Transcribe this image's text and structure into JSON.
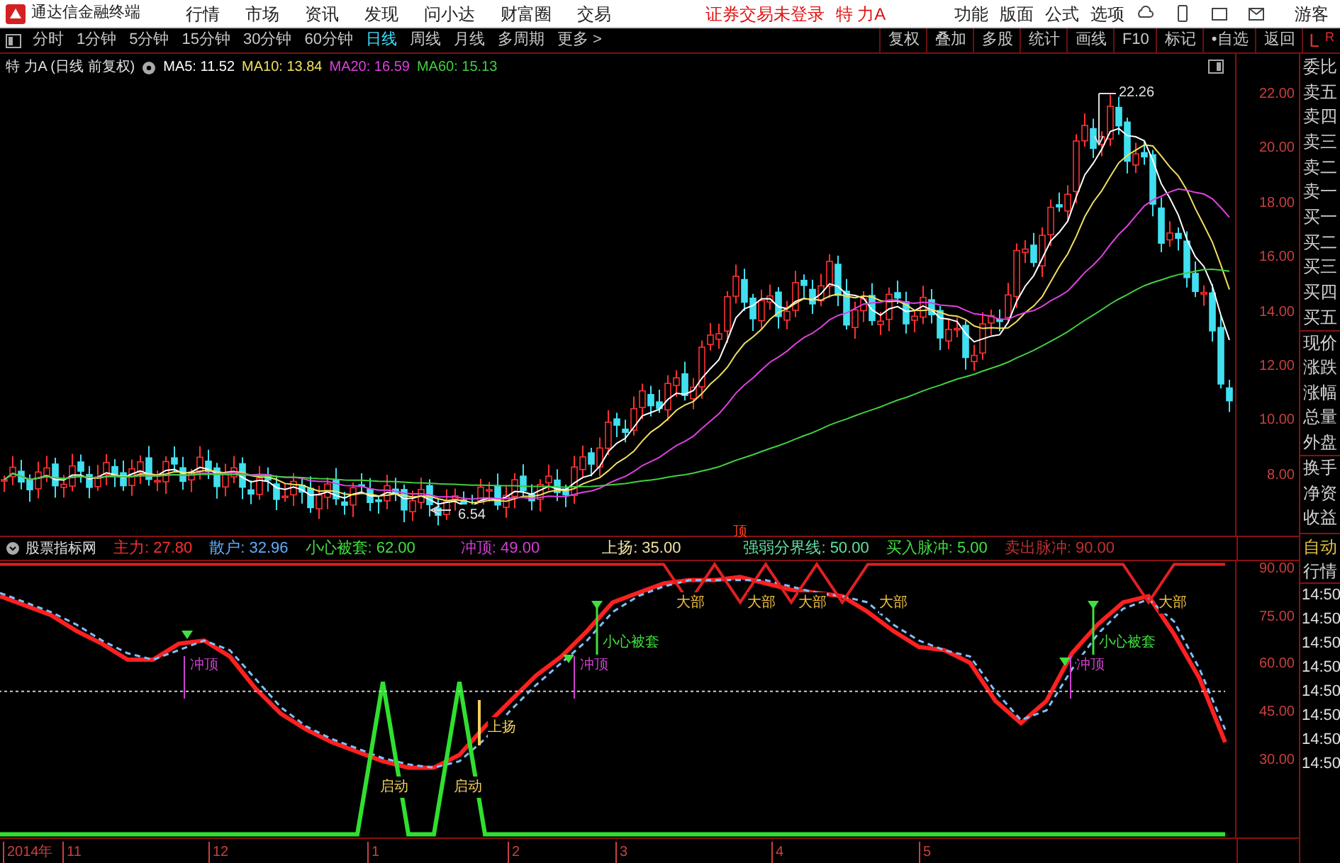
{
  "menu_bar": {
    "title": "通达信金融终端",
    "menu": [
      "行情",
      "市场",
      "资讯",
      "发现",
      "问小达",
      "财富圈",
      "交易"
    ],
    "notice": "证券交易未登录",
    "stock": "特 力A",
    "tools": [
      "功能",
      "版面",
      "公式",
      "选项"
    ],
    "user": "游客"
  },
  "toolbar": {
    "periods": [
      {
        "label": "分时",
        "selected": false
      },
      {
        "label": "1分钟",
        "selected": false
      },
      {
        "label": "5分钟",
        "selected": false
      },
      {
        "label": "15分钟",
        "selected": false
      },
      {
        "label": "30分钟",
        "selected": false
      },
      {
        "label": "60分钟",
        "selected": false
      },
      {
        "label": "日线",
        "selected": true
      },
      {
        "label": "周线",
        "selected": false
      },
      {
        "label": "月线",
        "selected": false
      },
      {
        "label": "多周期",
        "selected": false
      },
      {
        "label": "更多 >",
        "selected": false
      }
    ],
    "buttons": [
      "复权",
      "叠加",
      "多股",
      "统计",
      "画线",
      "F10",
      "标记",
      "•自选",
      "返回"
    ],
    "corner": [
      "L",
      "R"
    ]
  },
  "price_chart": {
    "title": "特 力A (日线 前复权)",
    "ma": [
      {
        "label": "MA5: 11.52",
        "color": "#ffffff"
      },
      {
        "label": "MA10: 13.84",
        "color": "#f0e060"
      },
      {
        "label": "MA20: 16.59",
        "color": "#e040e0"
      },
      {
        "label": "MA60: 15.13",
        "color": "#40d040"
      }
    ],
    "high_label": "22.26",
    "low_label": "6.54",
    "axis": [
      "22.00",
      "20.00",
      "18.00",
      "16.00",
      "14.00",
      "12.00",
      "10.00",
      "8.00"
    ]
  },
  "indicator": {
    "name": "股票指标网",
    "values": [
      {
        "label": "主力: 27.80",
        "color": "#ff3030"
      },
      {
        "label": "散户: 32.96",
        "color": "#60b0ff"
      },
      {
        "label": "小心被套: 62.00",
        "color": "#40e040"
      },
      {
        "label": "冲顶: 49.00",
        "color": "#d040d0"
      },
      {
        "label": "上扬: 35.00",
        "color": "#f0e0a0"
      },
      {
        "label": "强弱分界线: 50.00",
        "color": "#60e0a0"
      },
      {
        "label": "买入脉冲: 5.00",
        "color": "#40e040"
      },
      {
        "label": "卖出脉冲: 90.00",
        "color": "#c03030"
      }
    ],
    "peak_tag": "顶",
    "labels": [
      {
        "text": "冲顶",
        "kind": "top"
      },
      {
        "text": "启动",
        "kind": "rise"
      },
      {
        "text": "启动",
        "kind": "rise"
      },
      {
        "text": "上扬",
        "kind": "rise"
      },
      {
        "text": "冲顶",
        "kind": "top"
      },
      {
        "text": "小心被套",
        "kind": "trap"
      },
      {
        "text": "大部",
        "kind": "peak"
      },
      {
        "text": "大部",
        "kind": "peak"
      },
      {
        "text": "大部",
        "kind": "peak"
      },
      {
        "text": "大部",
        "kind": "peak"
      },
      {
        "text": "冲顶",
        "kind": "top"
      },
      {
        "text": "小心被套",
        "kind": "trap"
      },
      {
        "text": "大部",
        "kind": "peak"
      }
    ],
    "chart_data": {
      "type": "line",
      "ylim": [
        4,
        91
      ],
      "yticks": [
        {
          "value": 90,
          "label": "90.00"
        },
        {
          "value": 75,
          "label": "75.00"
        },
        {
          "value": 60,
          "label": "60.00"
        },
        {
          "value": 45,
          "label": "45.00"
        },
        {
          "value": 30,
          "label": "30.00"
        }
      ],
      "series": [
        {
          "color": "#ff2020",
          "values": [
            80,
            77,
            74,
            69,
            65,
            60,
            60,
            65,
            66,
            61,
            51,
            43,
            38,
            34,
            31,
            28,
            26,
            26,
            30,
            39,
            47,
            55,
            61,
            69,
            78,
            81,
            84,
            85,
            85,
            86,
            84,
            82,
            81,
            80,
            75,
            69,
            64,
            63,
            59,
            47,
            40,
            47,
            62,
            71,
            78,
            80,
            68,
            54,
            34
          ]
        },
        {
          "color": "#80c0ff",
          "line_style": "dashed",
          "values": [
            81,
            78,
            75,
            71,
            66,
            62,
            60,
            63,
            66,
            63,
            54,
            45,
            39,
            35,
            32,
            29,
            27,
            26,
            28,
            35,
            44,
            52,
            59,
            66,
            75,
            80,
            83,
            85,
            85,
            85,
            85,
            83,
            81,
            80,
            78,
            71,
            66,
            63,
            61,
            50,
            41,
            44,
            57,
            68,
            76,
            79,
            72,
            57,
            38
          ]
        },
        {
          "color": "#30e030",
          "values": [
            5,
            5,
            5,
            5,
            5,
            5,
            5,
            5,
            5,
            5,
            5,
            5,
            5,
            5,
            5,
            53,
            5,
            5,
            53,
            5,
            5,
            5,
            5,
            5,
            5,
            5,
            5,
            5,
            5,
            5,
            5,
            5,
            5,
            5,
            5,
            5,
            5,
            5,
            5,
            5,
            5,
            5,
            5,
            5,
            5,
            5,
            5,
            5,
            5
          ]
        },
        {
          "color": "#e02020",
          "values": [
            90,
            90,
            90,
            90,
            90,
            90,
            90,
            90,
            90,
            90,
            90,
            90,
            90,
            90,
            90,
            90,
            90,
            90,
            90,
            90,
            90,
            90,
            90,
            90,
            90,
            90,
            90,
            78,
            90,
            78,
            90,
            78,
            90,
            78,
            90,
            90,
            90,
            90,
            90,
            90,
            90,
            90,
            90,
            90,
            90,
            78,
            90,
            90,
            90
          ]
        },
        {
          "color": "#cccccc",
          "line_style": "dotted",
          "values": [
            50,
            50,
            50,
            50,
            50,
            50,
            50,
            50,
            50,
            50,
            50,
            50,
            50,
            50,
            50,
            50,
            50,
            50,
            50,
            50,
            50,
            50,
            50,
            50,
            50,
            50,
            50,
            50,
            50,
            50,
            50,
            50,
            50,
            50,
            50,
            50,
            50,
            50,
            50,
            50,
            50,
            50,
            50,
            50,
            50,
            50,
            50,
            50,
            50
          ]
        }
      ]
    }
  },
  "time_axis": [
    "2014年",
    "11",
    "12",
    "1",
    "2",
    "3",
    "4",
    "5"
  ],
  "quote_panel": {
    "rows": [
      "委比",
      "卖五",
      "卖四",
      "卖三",
      "卖二",
      "卖一",
      "买一",
      "买二",
      "买三",
      "买四",
      "买五",
      "现价",
      "涨跌",
      "涨幅",
      "总量",
      "外盘",
      "换手",
      "净资",
      "收益"
    ],
    "mode": [
      "自动",
      "行情"
    ],
    "times": [
      "14:50",
      "14:50",
      "14:50",
      "14:50",
      "14:50",
      "14:50",
      "14:50",
      "14:50"
    ]
  }
}
